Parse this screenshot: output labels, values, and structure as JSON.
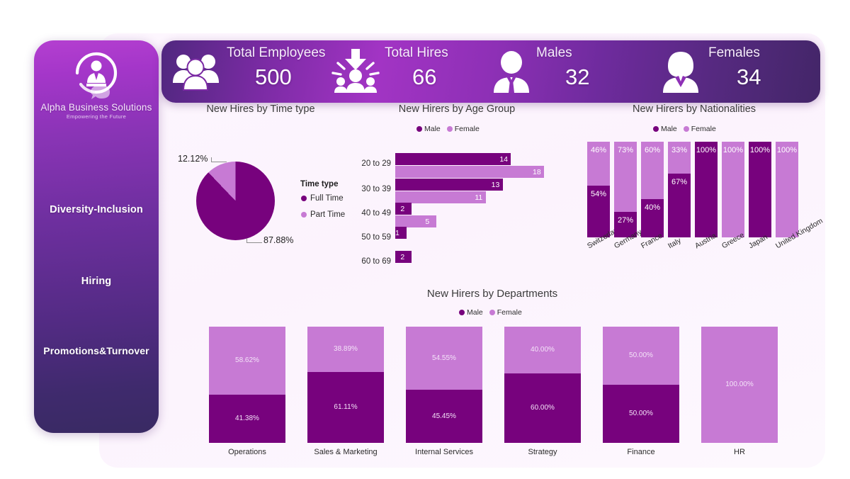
{
  "theme": {
    "male_color": "#77027d",
    "female_color": "#c77ad4",
    "panel_bg": "#fdf6fe",
    "page_bg": "#ffffff",
    "sidebar_top": "#b43fd0",
    "sidebar_bottom": "#392a63"
  },
  "sidebar": {
    "logo": {
      "name": "Alpha Business Solutions",
      "tagline": "Empowering the Future",
      "icon": "business-person-circle-icon"
    },
    "items": [
      {
        "label": "Diversity-Inclusion"
      },
      {
        "label": "Hiring"
      },
      {
        "label": "Promotions&Turnover"
      }
    ]
  },
  "kpis": [
    {
      "label": "Total Employees",
      "value": "500",
      "icon": "group-people-icon"
    },
    {
      "label": "Total Hires",
      "value": "66",
      "icon": "new-hire-arrow-icon"
    },
    {
      "label": "Males",
      "value": "32",
      "icon": "man-suit-icon"
    },
    {
      "label": "Females",
      "value": "34",
      "icon": "woman-icon"
    }
  ],
  "chart_data": [
    {
      "id": "time_type",
      "type": "pie",
      "title": "New Hires by Time type",
      "legend_title": "Time type",
      "legend_position": "right",
      "categories": [
        "Full Time",
        "Part Time"
      ],
      "values": [
        87.88,
        12.12
      ],
      "labels": [
        "87.88%",
        "12.12%"
      ],
      "colors": [
        "#77027d",
        "#c77ad4"
      ]
    },
    {
      "id": "age_group",
      "type": "bar",
      "orientation": "horizontal",
      "title": "New Hirers by Age Group",
      "legend": [
        "Male",
        "Female"
      ],
      "categories": [
        "20 to 29",
        "30 to 39",
        "40 to 49",
        "50 to 59",
        "60 to 69"
      ],
      "series": [
        {
          "name": "Male",
          "values": [
            14,
            13,
            2,
            1,
            2
          ]
        },
        {
          "name": "Female",
          "values": [
            18,
            11,
            5,
            0,
            0
          ]
        }
      ],
      "xlabel": "",
      "ylabel": "",
      "xlim": [
        0,
        18
      ],
      "grid": false
    },
    {
      "id": "nationalities",
      "type": "bar",
      "orientation": "vertical",
      "stacked": "percent",
      "title": "New Hirers by Nationalities",
      "legend": [
        "Male",
        "Female"
      ],
      "categories": [
        "Switzerland",
        "Germany",
        "France",
        "Italy",
        "Austria",
        "Greece",
        "Japan",
        "United Kingdom"
      ],
      "series": [
        {
          "name": "Male",
          "values": [
            54,
            27,
            40,
            67,
            100,
            0,
            100,
            0
          ],
          "labels": [
            "54%",
            "27%",
            "40%",
            "67%",
            "100%",
            "",
            "100%",
            ""
          ]
        },
        {
          "name": "Female",
          "values": [
            46,
            73,
            60,
            33,
            0,
            100,
            0,
            100
          ],
          "labels": [
            "46%",
            "73%",
            "60%",
            "33%",
            "",
            "100%",
            "",
            "100%"
          ]
        }
      ],
      "ylim": [
        0,
        100
      ],
      "grid": false
    },
    {
      "id": "departments",
      "type": "bar",
      "orientation": "vertical",
      "stacked": "percent",
      "title": "New Hirers by Departments",
      "legend": [
        "Male",
        "Female"
      ],
      "categories": [
        "Operations",
        "Sales & Marketing",
        "Internal Services",
        "Strategy",
        "Finance",
        "HR"
      ],
      "series": [
        {
          "name": "Male",
          "values": [
            41.38,
            61.11,
            45.45,
            60.0,
            50.0,
            0
          ],
          "labels": [
            "41.38%",
            "61.11%",
            "45.45%",
            "60.00%",
            "50.00%",
            ""
          ]
        },
        {
          "name": "Female",
          "values": [
            58.62,
            38.89,
            54.55,
            40.0,
            50.0,
            100.0
          ],
          "labels": [
            "58.62%",
            "38.89%",
            "54.55%",
            "40.00%",
            "50.00%",
            "100.00%"
          ]
        }
      ],
      "ylim": [
        0,
        100
      ],
      "grid": false
    }
  ]
}
